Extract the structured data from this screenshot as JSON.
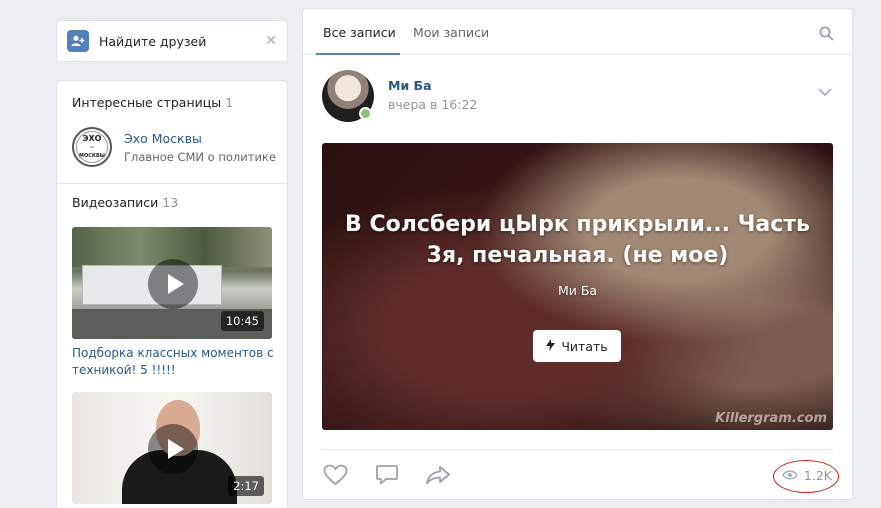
{
  "find_friends": {
    "label": "Найдите друзей",
    "close": "✕"
  },
  "left": {
    "interesting": {
      "title": "Интересные страницы",
      "count": "1",
      "items": [
        {
          "name": "Эхо Москвы",
          "desc": "Главное СМИ о политике",
          "logo_top": "ЭХО",
          "logo_bottom": "МОСКВЫ"
        }
      ]
    },
    "videos": {
      "title": "Видеозаписи",
      "count": "13",
      "items": [
        {
          "duration": "10:45",
          "title": "Подборка классных моментов с техникой! 5 !!!!!"
        },
        {
          "duration": "2:17"
        }
      ]
    }
  },
  "feed": {
    "tabs": [
      {
        "label": "Все записи",
        "active": true
      },
      {
        "label": "Мои записи",
        "active": false
      }
    ],
    "post": {
      "author": "Ми Ба",
      "time": "вчера в 16:22",
      "article": {
        "title": "В Солсбери цЫрк прикрыли... Часть 3я, печальная. (не мое)",
        "author": "Ми Ба",
        "read_label": "Читать",
        "watermark": "Killergram.com"
      },
      "views": "1.2K"
    }
  },
  "colors": {
    "accent": "#5181b8",
    "link": "#2a5885",
    "online": "#8ac176",
    "annotation": "#d31b1b"
  }
}
